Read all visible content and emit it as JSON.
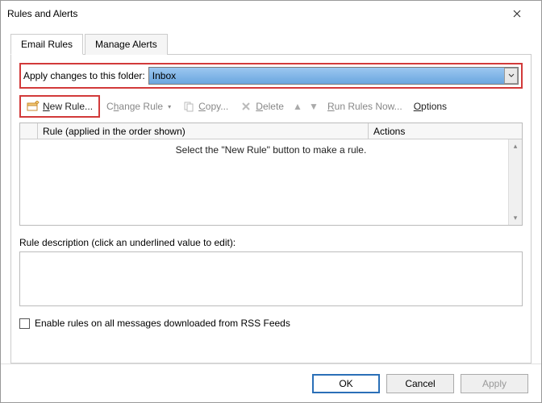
{
  "window": {
    "title": "Rules and Alerts"
  },
  "tabs": {
    "email_rules": "Email Rules",
    "manage_alerts": "Manage Alerts"
  },
  "folder": {
    "label": "Apply changes to this folder:",
    "value": "Inbox"
  },
  "toolbar": {
    "new_rule": "New Rule...",
    "change_rule": "Change Rule",
    "copy": "Copy...",
    "delete": "Delete",
    "run_rules_now": "Run Rules Now...",
    "options": "Options"
  },
  "list": {
    "col_rule": "Rule (applied in the order shown)",
    "col_actions": "Actions",
    "empty_msg": "Select the \"New Rule\" button to make a rule."
  },
  "description": {
    "label": "Rule description (click an underlined value to edit):"
  },
  "rss": {
    "label": "Enable rules on all messages downloaded from RSS Feeds"
  },
  "buttons": {
    "ok": "OK",
    "cancel": "Cancel",
    "apply": "Apply"
  }
}
